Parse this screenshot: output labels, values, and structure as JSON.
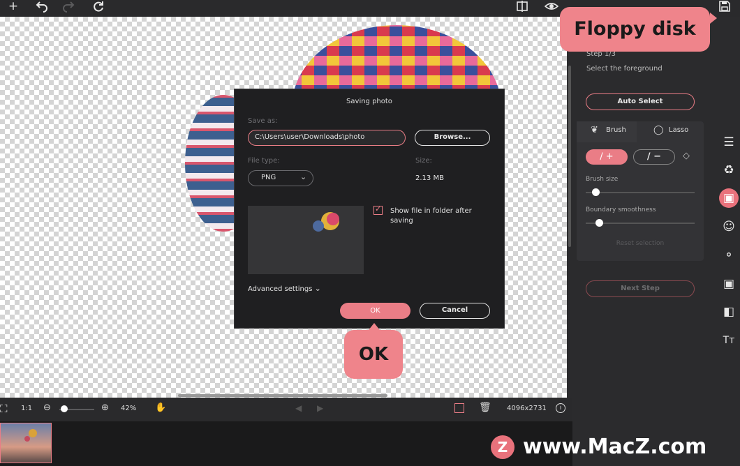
{
  "toolbar": {
    "add_icon": "plus-icon",
    "undo_icon": "undo-icon",
    "redo_icon": "redo-icon",
    "reset_icon": "reset-icon",
    "compare_icon": "compare-icon",
    "preview_icon": "eye-icon",
    "save_icon": "floppy-icon"
  },
  "callouts": {
    "floppy": "Floppy disk",
    "ok": "OK"
  },
  "dialog": {
    "title": "Saving photo",
    "save_as_label": "Save as:",
    "path_value": "C:\\Users\\user\\Downloads\\photo",
    "browse_label": "Browse...",
    "file_type_label": "File type:",
    "file_type_value": "PNG",
    "size_label": "Size:",
    "size_value": "2.13 MB",
    "show_in_folder_label": "Show file in folder after saving",
    "show_in_folder_checked": true,
    "advanced_label": "Advanced settings",
    "ok_label": "OK",
    "cancel_label": "Cancel"
  },
  "panel": {
    "step": "Step 1/3",
    "instruction": "Select the foreground",
    "auto_select": "Auto Select",
    "tab_brush": "Brush",
    "tab_lasso": "Lasso",
    "brush_size_label": "Brush size",
    "boundary_label": "Boundary smoothness",
    "reset_selection": "Reset selection",
    "next_step": "Next Step"
  },
  "bottom": {
    "fit_icon": "fit-screen-icon",
    "one_to_one": "1:1",
    "zoom": "42%",
    "zoom_slider_fraction": 0.08,
    "dimensions": "4096x2731"
  },
  "watermark": {
    "badge": "Z",
    "text": "www.MacZ.com"
  },
  "colors": {
    "accent": "#ea7d86",
    "panel_bg": "#2b2b2d",
    "dialog_bg": "#1f1f21"
  }
}
